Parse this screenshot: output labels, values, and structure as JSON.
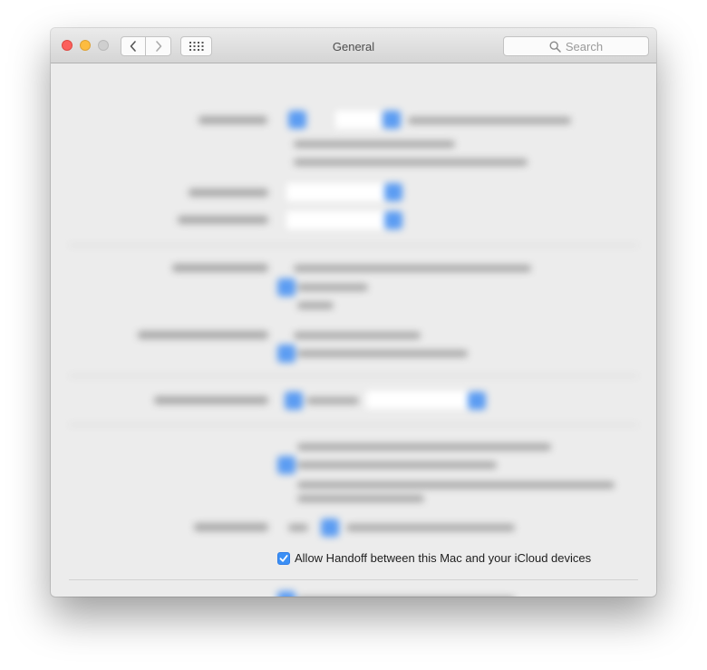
{
  "window": {
    "title": "General",
    "search_placeholder": "Search",
    "traffic_lights": [
      "close",
      "minimize",
      "zoom"
    ]
  },
  "handoff": {
    "label": "Allow Handoff between this Mac and your iCloud devices",
    "checked": true
  },
  "help": {
    "label": "?"
  },
  "colors": {
    "accent": "#3b8ff5",
    "close": "#fc605c",
    "minimize": "#fdbc40"
  },
  "icons": {
    "back": "chevron-left-icon",
    "forward": "chevron-right-icon",
    "grid": "grid-icon",
    "search": "search-icon",
    "check": "checkmark-icon"
  }
}
